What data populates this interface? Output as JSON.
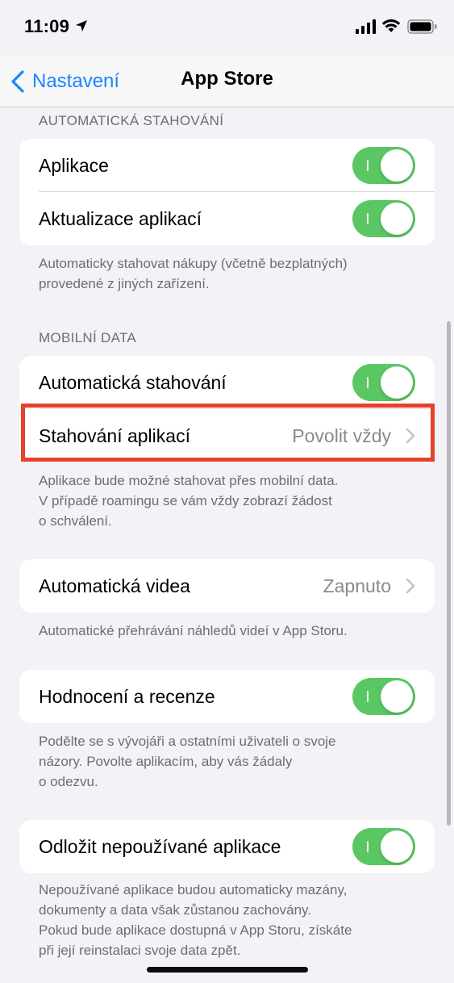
{
  "status_bar": {
    "time": "11:09",
    "icons": [
      "location-arrow-icon",
      "cellular-signal-icon",
      "wifi-icon",
      "battery-icon"
    ]
  },
  "nav": {
    "back_label": "Nastavení",
    "title": "App Store"
  },
  "sections": {
    "auto_downloads": {
      "header": "AUTOMATICKÁ STAHOVÁNÍ",
      "rows": [
        {
          "label": "Aplikace",
          "toggle_on": true
        },
        {
          "label": "Aktualizace aplikací",
          "toggle_on": true
        }
      ],
      "footer_lines": [
        "Automaticky stahovat nákupy (včetně bezplatných)",
        "provedené z jiných zařízení."
      ]
    },
    "mobile_data": {
      "header": "MOBILNÍ DATA",
      "rows": [
        {
          "label": "Automatická stahování",
          "toggle_on": true
        },
        {
          "label": "Stahování aplikací",
          "value": "Povolit vždy"
        }
      ],
      "footer_lines": [
        "Aplikace bude možné stahovat přes mobilní data.",
        "V případě roamingu se vám vždy zobrazí žádost",
        "o schválení."
      ]
    },
    "videos": {
      "rows": [
        {
          "label": "Automatická videa",
          "value": "Zapnuto"
        }
      ],
      "footer_lines": [
        "Automatické přehrávání náhledů videí v App Storu."
      ]
    },
    "ratings": {
      "rows": [
        {
          "label": "Hodnocení a recenze",
          "toggle_on": true
        }
      ],
      "footer_lines": [
        "Podělte se s vývojáři a ostatními uživateli o svoje",
        "názory. Povolte aplikacím, aby vás žádaly",
        "o odezvu."
      ]
    },
    "offload": {
      "rows": [
        {
          "label": "Odložit nepoužívané aplikace",
          "toggle_on": true
        }
      ],
      "footer_lines": [
        "Nepoužívané aplikace budou automaticky mazány,",
        "dokumenty a data však zůstanou zachovány.",
        "Pokud bude aplikace dostupná v App Storu, získáte",
        "při její reinstalaci svoje data zpět."
      ]
    }
  },
  "colors": {
    "accent_blue": "#1a84ff",
    "toggle_green": "#5ac764",
    "highlight_red": "#e5412b",
    "background": "#f2f2f7"
  }
}
